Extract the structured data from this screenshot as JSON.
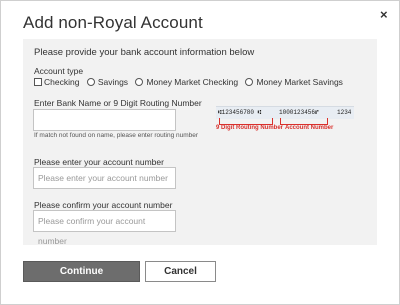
{
  "dialog": {
    "title": "Add non-Royal Account",
    "close_glyph": "×"
  },
  "form": {
    "intro": "Please provide your bank account information below",
    "account_type_label": "Account type",
    "account_types": [
      {
        "label": "Checking",
        "control": "checkbox",
        "checked": false
      },
      {
        "label": "Savings",
        "control": "radio",
        "checked": false
      },
      {
        "label": "Money Market Checking",
        "control": "radio",
        "checked": false
      },
      {
        "label": "Money Market Savings",
        "control": "radio",
        "checked": false
      }
    ],
    "bank_label": "Enter Bank Name or 9 Digit Routing Number",
    "bank_value": "",
    "bank_hint": "If match not found on name, please enter routing number",
    "account_label": "Please enter your account number",
    "account_placeholder": "Please enter your account number",
    "confirm_label": "Please confirm your account number",
    "confirm_placeholder": "Please confirm your account number"
  },
  "check_image": {
    "routing_digits": "⑆123456780 ⑆",
    "account_digits": "1000123456⑈",
    "check_no": "1234",
    "routing_label": "9 Digit Routing Number",
    "account_label": "Account Number",
    "accent_color": "#d9302c"
  },
  "buttons": {
    "continue": "Continue",
    "cancel": "Cancel"
  }
}
